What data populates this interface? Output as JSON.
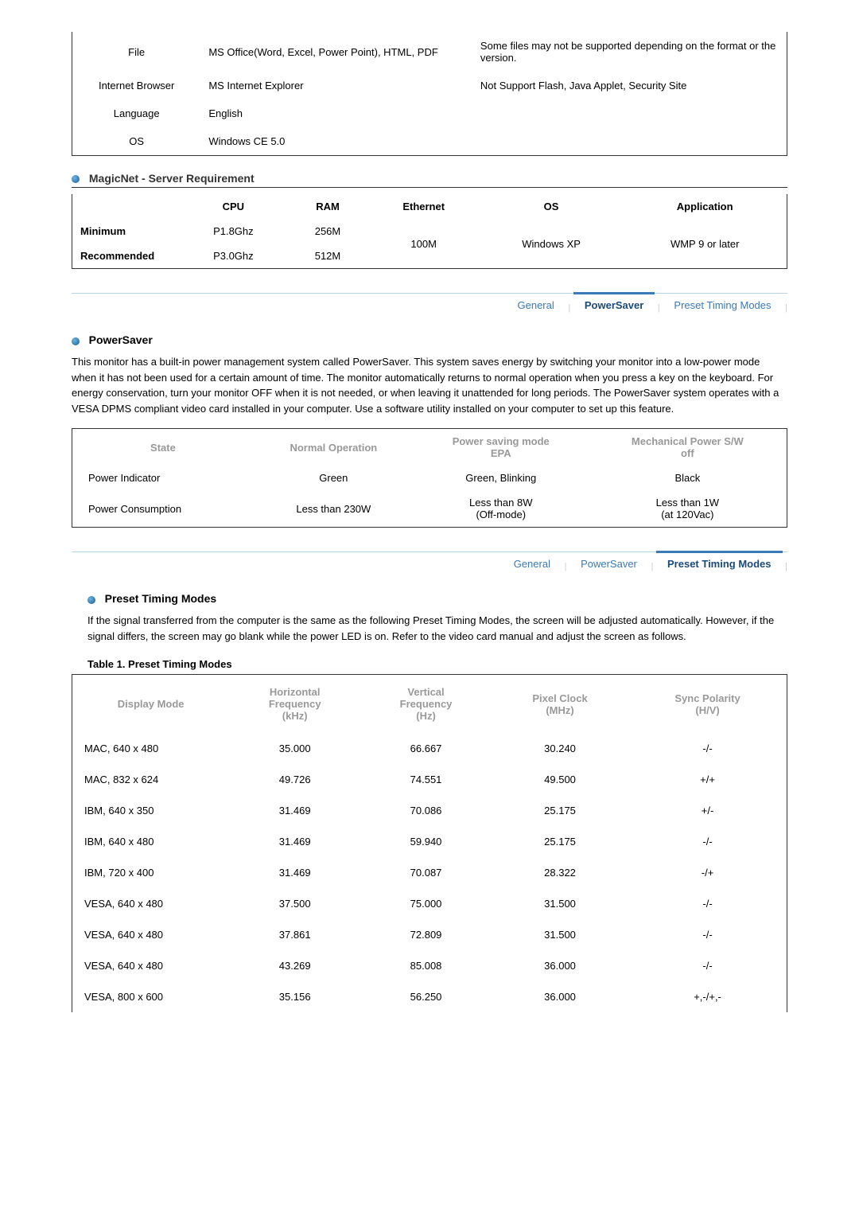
{
  "top_table": {
    "rows": [
      {
        "label": "File",
        "col1": "MS Office(Word, Excel, Power Point), HTML, PDF",
        "col2": "Some files may not be supported depending on the format or the version."
      },
      {
        "label": "Internet Browser",
        "col1": "MS Internet Explorer",
        "col2": "Not Support Flash, Java Applet, Security Site"
      },
      {
        "label": "Language",
        "col1": "English",
        "col2": ""
      },
      {
        "label": "OS",
        "col1": "Windows CE 5.0",
        "col2": ""
      }
    ]
  },
  "magicnet": {
    "title": "MagicNet - Server Requirement",
    "headers": [
      "",
      "CPU",
      "RAM",
      "Ethernet",
      "OS",
      "Application"
    ],
    "minimum": {
      "label": "Minimum",
      "cpu": "P1.8Ghz",
      "ram": "256M"
    },
    "recommended": {
      "label": "Recommended",
      "cpu": "P3.0Ghz",
      "ram": "512M"
    },
    "ethernet": "100M",
    "os": "Windows XP",
    "app": "WMP 9 or later"
  },
  "tabs": {
    "general": "General",
    "powersaver": "PowerSaver",
    "preset": "Preset Timing Modes"
  },
  "powersaver": {
    "title": "PowerSaver",
    "desc": "This monitor has a built-in power management system called PowerSaver. This system saves energy by switching your monitor into a low-power mode when it has not been used for a certain amount of time. The monitor automatically returns to normal operation when you press a key on the keyboard. For energy conservation, turn your monitor OFF when it is not needed, or when leaving it unattended for long periods. The PowerSaver system operates with a VESA DPMS compliant video card installed in your computer. Use a software utility installed on your computer to set up this feature.",
    "headers": [
      "State",
      "Normal Operation",
      "Power saving mode EPA",
      "Mechanical Power S/W off"
    ],
    "rows": [
      {
        "c0": "Power Indicator",
        "c1": "Green",
        "c2": "Green, Blinking",
        "c3": "Black"
      },
      {
        "c0": "Power Consumption",
        "c1": "Less than 230W",
        "c2": "Less than 8W\n(Off-mode)",
        "c3": "Less than 1W\n(at 120Vac)"
      }
    ]
  },
  "preset": {
    "title": "Preset Timing Modes",
    "desc": "If the signal transferred from the computer is the same as the following Preset Timing Modes, the screen will be adjusted automatically. However, if the signal differs, the screen may go blank while the power LED is on. Refer to the video card manual and adjust the screen as follows.",
    "table_title": "Table 1. Preset Timing Modes",
    "headers": [
      "Display Mode",
      "Horizontal Frequency (kHz)",
      "Vertical Frequency (Hz)",
      "Pixel Clock (MHz)",
      "Sync Polarity (H/V)"
    ],
    "rows": [
      {
        "c0": "MAC, 640 x 480",
        "c1": "35.000",
        "c2": "66.667",
        "c3": "30.240",
        "c4": "-/-"
      },
      {
        "c0": "MAC, 832 x 624",
        "c1": "49.726",
        "c2": "74.551",
        "c3": "49.500",
        "c4": "+/+"
      },
      {
        "c0": "IBM, 640 x 350",
        "c1": "31.469",
        "c2": "70.086",
        "c3": "25.175",
        "c4": "+/-"
      },
      {
        "c0": "IBM, 640 x 480",
        "c1": "31.469",
        "c2": "59.940",
        "c3": "25.175",
        "c4": "-/-"
      },
      {
        "c0": "IBM, 720 x 400",
        "c1": "31.469",
        "c2": "70.087",
        "c3": "28.322",
        "c4": "-/+"
      },
      {
        "c0": "VESA, 640 x 480",
        "c1": "37.500",
        "c2": "75.000",
        "c3": "31.500",
        "c4": "-/-"
      },
      {
        "c0": "VESA, 640 x 480",
        "c1": "37.861",
        "c2": "72.809",
        "c3": "31.500",
        "c4": "-/-"
      },
      {
        "c0": "VESA, 640 x 480",
        "c1": "43.269",
        "c2": "85.008",
        "c3": "36.000",
        "c4": "-/-"
      },
      {
        "c0": "VESA, 800 x 600",
        "c1": "35.156",
        "c2": "56.250",
        "c3": "36.000",
        "c4": "+,-/+,-"
      }
    ]
  }
}
